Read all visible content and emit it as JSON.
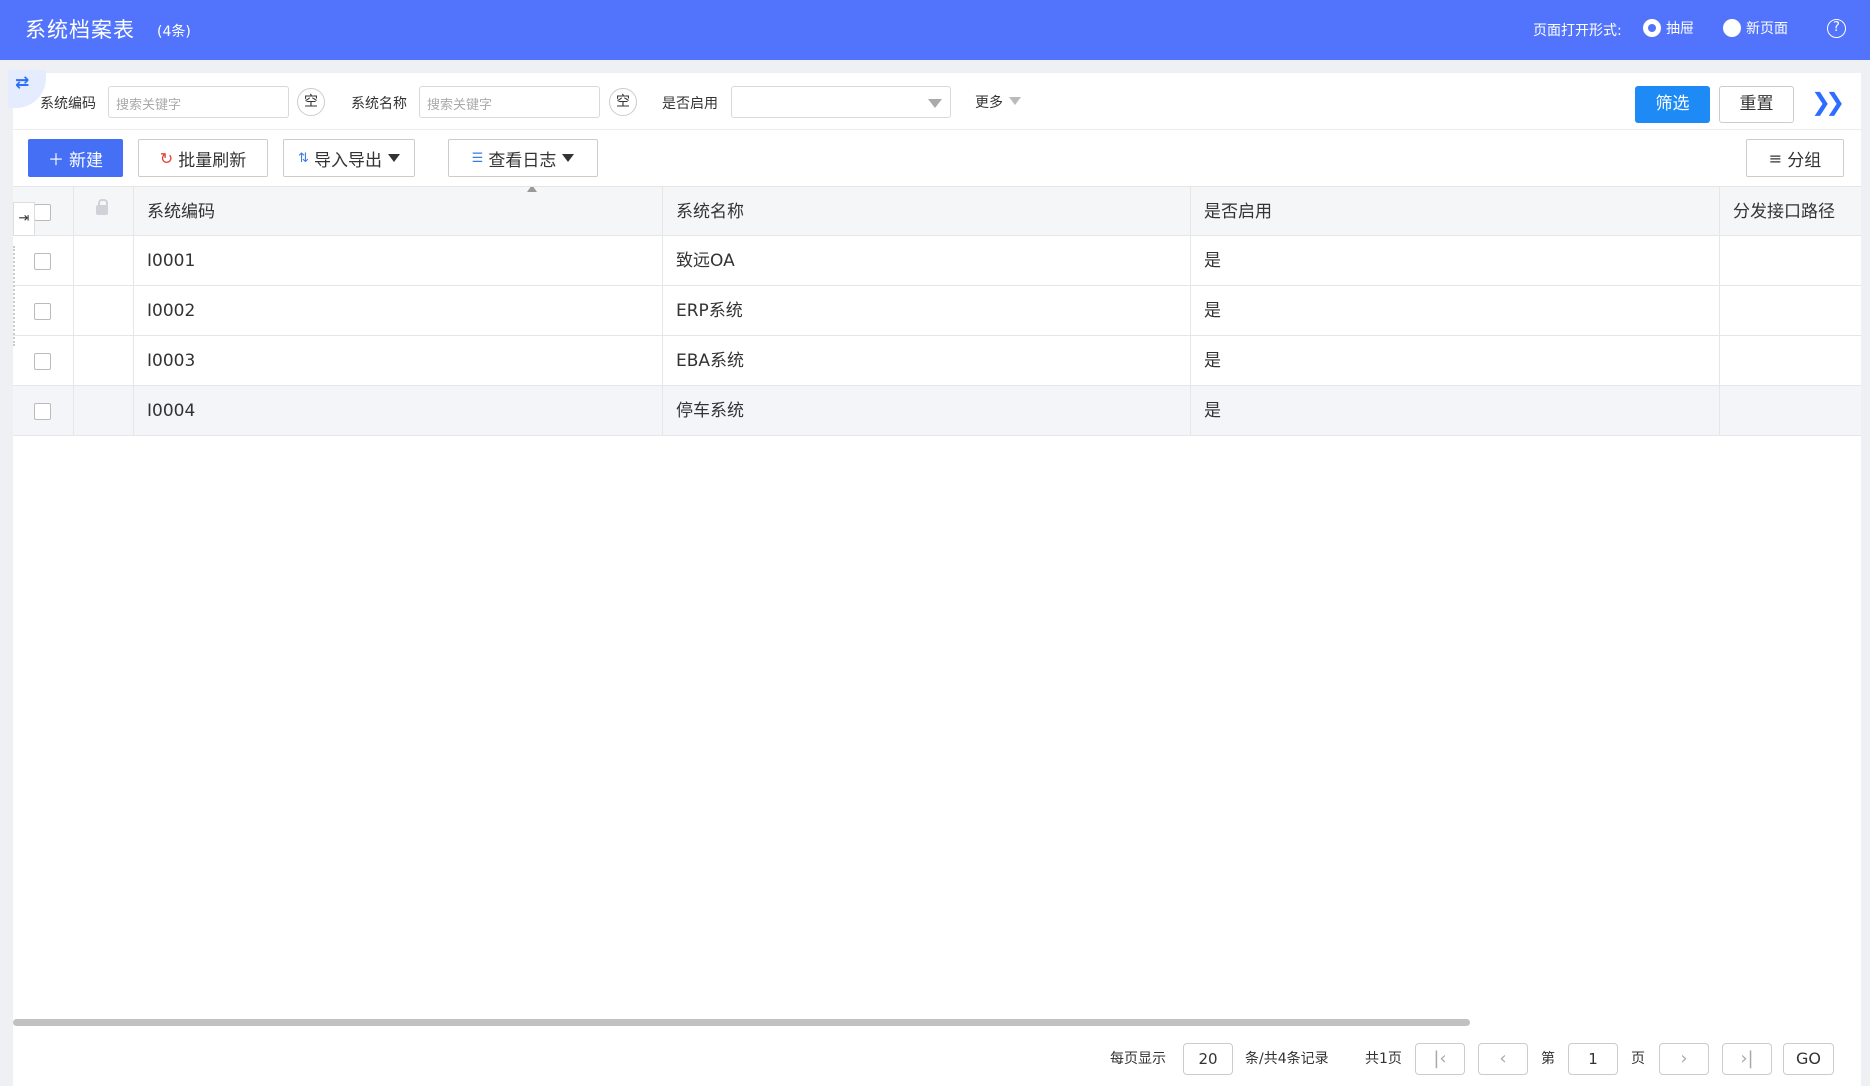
{
  "header": {
    "title": "系统档案表",
    "count": "(4条)",
    "open_mode_label": "页面打开形式:",
    "open_modes": [
      "抽屉",
      "新页面"
    ],
    "selected_mode": "抽屉",
    "help_icon": "?"
  },
  "filters": {
    "code_label": "系统编码",
    "code_placeholder": "搜索关键字",
    "name_label": "系统名称",
    "name_placeholder": "搜索关键字",
    "empty_label": "空",
    "enabled_label": "是否启用",
    "enabled_value": "",
    "more_label": "更多",
    "filter_button": "筛选",
    "reset_button": "重置"
  },
  "toolbar": {
    "new": "新建",
    "batch_refresh": "批量刷新",
    "import_export": "导入导出",
    "view_log": "查看日志",
    "group": "分组"
  },
  "table": {
    "columns": [
      "系统编码",
      "系统名称",
      "是否启用",
      "分发接口路径"
    ],
    "rows": [
      {
        "code": "I0001",
        "name": "致远OA",
        "enabled": "是",
        "path": ""
      },
      {
        "code": "I0002",
        "name": "ERP系统",
        "enabled": "是",
        "path": ""
      },
      {
        "code": "I0003",
        "name": "EBA系统",
        "enabled": "是",
        "path": ""
      },
      {
        "code": "I0004",
        "name": "停车系统",
        "enabled": "是",
        "path": ""
      }
    ]
  },
  "pagination": {
    "per_page_label": "每页显示",
    "per_page": "20",
    "records_label": "条/共4条记录",
    "total_pages": "共1页",
    "page_prefix": "第",
    "current_page": "1",
    "page_suffix": "页",
    "go": "GO"
  }
}
